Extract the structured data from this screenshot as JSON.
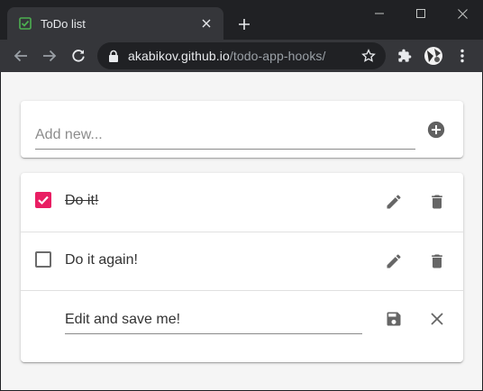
{
  "browser": {
    "tab_title": "ToDo list",
    "url_host": "akabikov.github.io",
    "url_path": "/todo-app-hooks/"
  },
  "add_form": {
    "placeholder": "Add new..."
  },
  "todos": [
    {
      "text": "Do it!",
      "completed": true,
      "editing": false
    },
    {
      "text": "Do it again!",
      "completed": false,
      "editing": false
    },
    {
      "text": "Edit and save me!",
      "completed": false,
      "editing": true
    }
  ],
  "colors": {
    "accent": "#e91e63",
    "icon": "#666666",
    "page_background": "#f5f5f5"
  },
  "icons": {
    "tab_favicon": "checkbox-icon",
    "add": "plus-circle-icon",
    "edit": "pencil-icon",
    "delete": "trash-icon",
    "save": "floppy-disk-icon",
    "cancel": "close-icon"
  }
}
